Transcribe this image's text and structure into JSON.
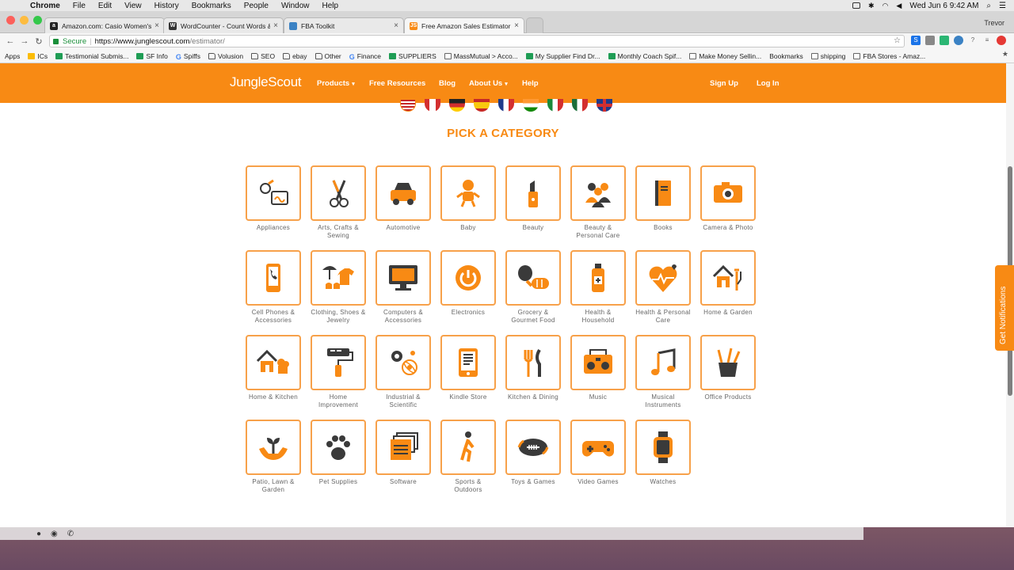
{
  "menubar": {
    "app": "Chrome",
    "items": [
      "File",
      "Edit",
      "View",
      "History",
      "Bookmarks",
      "People",
      "Window",
      "Help"
    ],
    "clock": "Wed Jun 6  9:42 AM"
  },
  "tabs": [
    {
      "title": "Amazon.com: Casio Women's",
      "favicon": "a",
      "color": "#222"
    },
    {
      "title": "WordCounter - Count Words &",
      "favicon": "W",
      "color": "#333"
    },
    {
      "title": "FBA Toolkit",
      "favicon": "",
      "color": "#3b82c4"
    },
    {
      "title": "Free Amazon Sales Estimator",
      "favicon": "JS",
      "color": "#f88a14"
    }
  ],
  "profile_name": "Trevor",
  "address": {
    "secure_label": "Secure",
    "url_host": "https://www.junglescout.com",
    "url_path": "/estimator/"
  },
  "bookmarks": [
    {
      "label": "Apps",
      "icon": "grid"
    },
    {
      "label": "ICs",
      "icon": "drive"
    },
    {
      "label": "Testimonial Submis...",
      "icon": "sheet"
    },
    {
      "label": "SF Info",
      "icon": "sheet"
    },
    {
      "label": "Spiffs",
      "icon": "google"
    },
    {
      "label": "Volusion",
      "icon": "folder"
    },
    {
      "label": "SEO",
      "icon": "folder"
    },
    {
      "label": "ebay",
      "icon": "folder"
    },
    {
      "label": "Other",
      "icon": "folder"
    },
    {
      "label": "Finance",
      "icon": "google"
    },
    {
      "label": "SUPPLIERS",
      "icon": "sheet"
    },
    {
      "label": "MassMutual > Acco...",
      "icon": "doc"
    },
    {
      "label": "My Supplier Find Dr...",
      "icon": "sheet"
    },
    {
      "label": "Monthly Coach Spif...",
      "icon": "sheet"
    },
    {
      "label": "Make Money Sellin...",
      "icon": "doc"
    },
    {
      "label": "Bookmarks",
      "icon": "star"
    },
    {
      "label": "shipping",
      "icon": "doc"
    },
    {
      "label": "FBA Stores - Amaz...",
      "icon": "doc"
    }
  ],
  "site_nav": {
    "logo_main": "Jungle",
    "logo_sub": "Scout",
    "links": [
      "Products",
      "Free Resources",
      "Blog",
      "About Us",
      "Help"
    ],
    "signup": "Sign Up",
    "login": "Log In"
  },
  "heading": "PICK A CATEGORY",
  "categories": [
    {
      "label": "Appliances",
      "icon": "appliances-icon"
    },
    {
      "label": "Arts, Crafts & Sewing",
      "icon": "scissors-icon"
    },
    {
      "label": "Automotive",
      "icon": "car-icon"
    },
    {
      "label": "Baby",
      "icon": "baby-icon"
    },
    {
      "label": "Beauty",
      "icon": "lipstick-icon"
    },
    {
      "label": "Beauty & Personal Care",
      "icon": "people-icon"
    },
    {
      "label": "Books",
      "icon": "book-icon"
    },
    {
      "label": "Camera & Photo",
      "icon": "camera-icon"
    },
    {
      "label": "Cell Phones & Accessories",
      "icon": "phone-icon"
    },
    {
      "label": "Clothing, Shoes & Jewelry",
      "icon": "clothing-icon"
    },
    {
      "label": "Computers & Accessories",
      "icon": "monitor-icon"
    },
    {
      "label": "Electronics",
      "icon": "power-icon"
    },
    {
      "label": "Grocery & Gourmet Food",
      "icon": "food-icon"
    },
    {
      "label": "Health & Household",
      "icon": "bottle-icon"
    },
    {
      "label": "Health & Personal Care",
      "icon": "heart-icon"
    },
    {
      "label": "Home & Garden",
      "icon": "house-tools-icon"
    },
    {
      "label": "Home & Kitchen",
      "icon": "house-chef-icon"
    },
    {
      "label": "Home Improvement",
      "icon": "paint-roller-icon"
    },
    {
      "label": "Industrial & Scientific",
      "icon": "gears-icon"
    },
    {
      "label": "Kindle Store",
      "icon": "ereader-icon"
    },
    {
      "label": "Kitchen & Dining",
      "icon": "utensils-icon"
    },
    {
      "label": "Music",
      "icon": "boombox-icon"
    },
    {
      "label": "Musical Instruments",
      "icon": "music-note-icon"
    },
    {
      "label": "Office Products",
      "icon": "pencil-cup-icon"
    },
    {
      "label": "Patio, Lawn & Garden",
      "icon": "plant-hands-icon"
    },
    {
      "label": "Pet Supplies",
      "icon": "paw-icon"
    },
    {
      "label": "Software",
      "icon": "windows-icon"
    },
    {
      "label": "Sports & Outdoors",
      "icon": "walker-icon"
    },
    {
      "label": "Toys & Games",
      "icon": "football-icon"
    },
    {
      "label": "Video Games",
      "icon": "gamepad-icon"
    },
    {
      "label": "Watches",
      "icon": "watch-icon"
    }
  ],
  "notification_tab": "Get Notifications",
  "colors": {
    "brand": "#f88a14",
    "card_border": "#f7a14a",
    "icon_dark": "#3a3a3a"
  }
}
